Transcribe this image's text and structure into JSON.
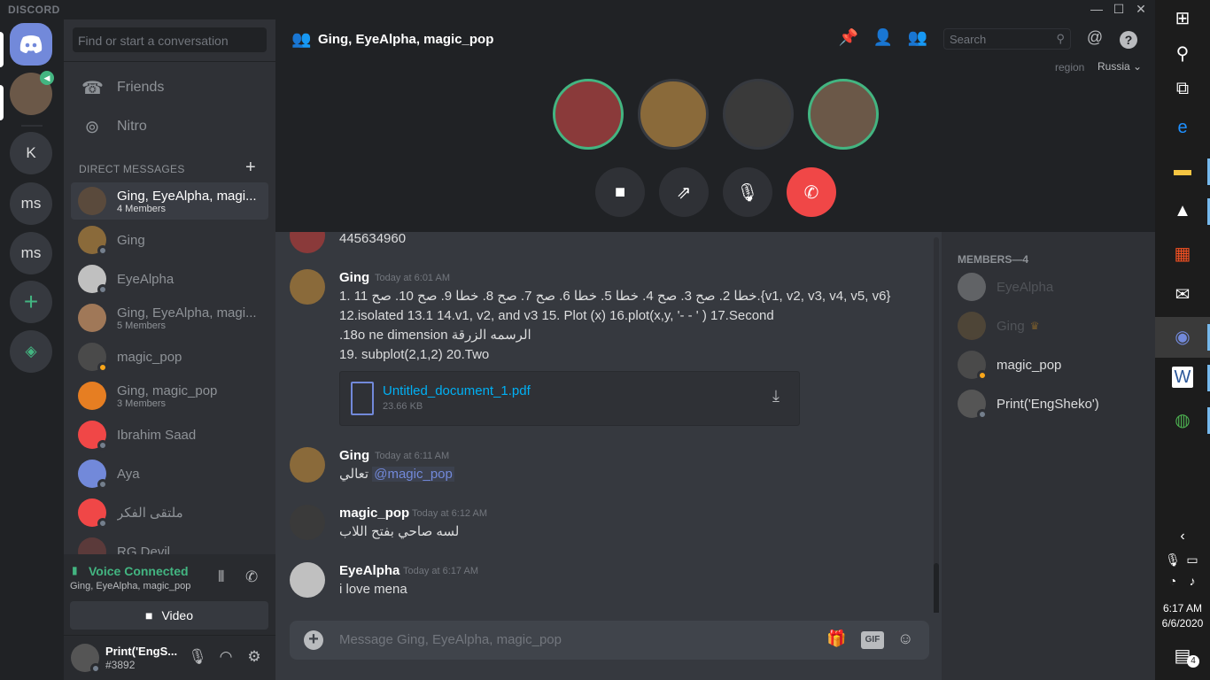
{
  "app": {
    "brand": "DISCORD"
  },
  "window_controls": {
    "minimize": "—",
    "maximize": "☐",
    "close": "✕"
  },
  "guilds": [
    {
      "label": "K"
    },
    {
      "label": "ms"
    },
    {
      "label": "ms"
    }
  ],
  "sidebar": {
    "search_placeholder": "Find or start a conversation",
    "nav": [
      {
        "label": "Friends"
      },
      {
        "label": "Nitro"
      }
    ],
    "dm_title": "DIRECT MESSAGES",
    "dm_add": "+",
    "dms": [
      {
        "name": "Ging, EyeAlpha, magi...",
        "sub": "4 Members",
        "active": true
      },
      {
        "name": "Ging",
        "sub": ""
      },
      {
        "name": "EyeAlpha",
        "sub": ""
      },
      {
        "name": "Ging, EyeAlpha, magi...",
        "sub": "5 Members"
      },
      {
        "name": "magic_pop",
        "sub": ""
      },
      {
        "name": "Ging, magic_pop",
        "sub": "3 Members"
      },
      {
        "name": "Ibrahim Saad",
        "sub": ""
      },
      {
        "name": "Aya",
        "sub": ""
      },
      {
        "name": "ملتقى الفكر",
        "sub": ""
      },
      {
        "name": "RG Devil",
        "sub": ""
      }
    ],
    "voice": {
      "status": "Voice Connected",
      "channel": "Ging, EyeAlpha, magic_pop",
      "video_label": "Video"
    },
    "user": {
      "name": "Print('EngS...",
      "tag": "#3892"
    }
  },
  "header": {
    "title": "Ging, EyeAlpha, magic_pop",
    "search_placeholder": "Search",
    "region_label": "region",
    "region_value": "Russia"
  },
  "messages": {
    "prev_tail": "445634960",
    "m1": {
      "author": "Ging",
      "time": "Today at 6:01 AM",
      "lines": [
        "1. خطا 2. صح 3. صح 4. خطا 5. خطا 6. صح 7. صح 8. خطا 9. صح 10. صح 11.{v1, v2, v3, v4, v5, v6}",
        "12.isolated 13.1 14.v1, v2, and v3  15. Plot (x)  16.plot(x,y, '- - ' )  17.Second",
        ".18o  ne dimension الرسمه الزرقة",
        "19. subplot(2,1,2)  20.Two"
      ],
      "attachment": {
        "name": "Untitled_document_1.pdf",
        "size": "23.66 KB"
      }
    },
    "m2": {
      "author": "Ging",
      "time": "Today at 6:11 AM",
      "text": "تعالي",
      "mention": "@magic_pop"
    },
    "m3": {
      "author": "magic_pop",
      "time": "Today at 6:12 AM",
      "text": "لسه صاحي بفتح اللاب"
    },
    "m4": {
      "author": "EyeAlpha",
      "time": "Today at 6:17 AM",
      "text": "i love mena"
    }
  },
  "composer": {
    "placeholder": "Message Ging, EyeAlpha, magic_pop",
    "gif": "GIF"
  },
  "members": {
    "title": "MEMBERS—4",
    "list": [
      {
        "name": "EyeAlpha"
      },
      {
        "name": "Ging"
      },
      {
        "name": "magic_pop"
      },
      {
        "name": "Print('EngSheko')"
      }
    ]
  },
  "taskbar": {
    "time": "6:17 AM",
    "date": "6/6/2020",
    "notifications": "4"
  },
  "colors": {
    "accent": "#7289da",
    "online": "#43b581",
    "danger": "#f04747",
    "link": "#00b0f4"
  }
}
